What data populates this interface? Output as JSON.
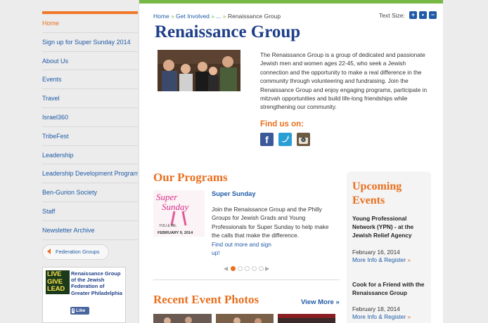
{
  "sidebar": {
    "items": [
      {
        "label": "Home"
      },
      {
        "label": "Sign up for Super Sunday 2014"
      },
      {
        "label": "About Us"
      },
      {
        "label": "Events"
      },
      {
        "label": "Travel"
      },
      {
        "label": "Israel360"
      },
      {
        "label": "TribeFest"
      },
      {
        "label": "Leadership"
      },
      {
        "label": "Leadership Development Program"
      },
      {
        "label": "Ben-Gurion Society"
      },
      {
        "label": "Staff"
      },
      {
        "label": "Newsletter Archive"
      }
    ],
    "federation_button": "Federation Groups",
    "facebook_box": {
      "logo_lines": [
        "LIVE",
        "GIVE",
        "LEAD"
      ],
      "page_name": "Renaissance Group of the Jewish Federation of Greater Philadelphia",
      "like_label": "Like",
      "like_icon": "f"
    }
  },
  "header": {
    "breadcrumb": {
      "home": "Home",
      "get_involved": "Get Involved",
      "ellipsis": "...",
      "current": "Renaissance Group",
      "separator": "»"
    },
    "text_size_label": "Text Size:",
    "text_size_buttons": [
      "+",
      "•",
      "−"
    ]
  },
  "main": {
    "title": "Renaissance Group",
    "intro": "The Renaissance Group is a group of dedicated and passionate Jewish men and women ages 22-45, who seek a Jewish connection and the opportunity to make a real difference in the community through volunteering and fundraising. Join the Renaissance Group and enjoy engaging programs, participate in mitzvah opportunities and build life-long friendships while strengthening our community.",
    "find_us": "Find us on:",
    "social": {
      "facebook": "f",
      "twitter": "t"
    },
    "programs": {
      "heading": "Our Programs",
      "image_lines": {
        "super": "Super",
        "sunday": "Sunday",
        "you_me": "YOU  &  ME.",
        "date": "FEBRUARY 9, 2014"
      },
      "title": "Super Sunday",
      "description": "Join the Renaissance Group and the Philly Groups for Jewish Grads and Young Professionals for Super Sunday to help make the calls that make the difference.",
      "link": "Find out more and sign up!",
      "carousel": {
        "prev": "◀",
        "next": "▶",
        "active_index": 0,
        "count": 5
      }
    },
    "photos": {
      "heading": "Recent Event Photos",
      "view_more": "View More »"
    }
  },
  "upcoming": {
    "title": "Upcoming Events",
    "events": [
      {
        "title": "Young Professional Network (YPN) - at the Jewish Relief Agency",
        "date": "February 16, 2014",
        "link": "More Info & Register",
        "arrow": "»"
      },
      {
        "title": "Cook for a Friend with the Renaissance Group",
        "date": "February 18, 2014",
        "link": "More Info & Register",
        "arrow": "»"
      }
    ]
  },
  "colors": {
    "accent_orange": "#e8701f",
    "link_blue": "#1f5aa6",
    "title_blue": "#1f3f8a",
    "green_bar": "#78b844"
  }
}
